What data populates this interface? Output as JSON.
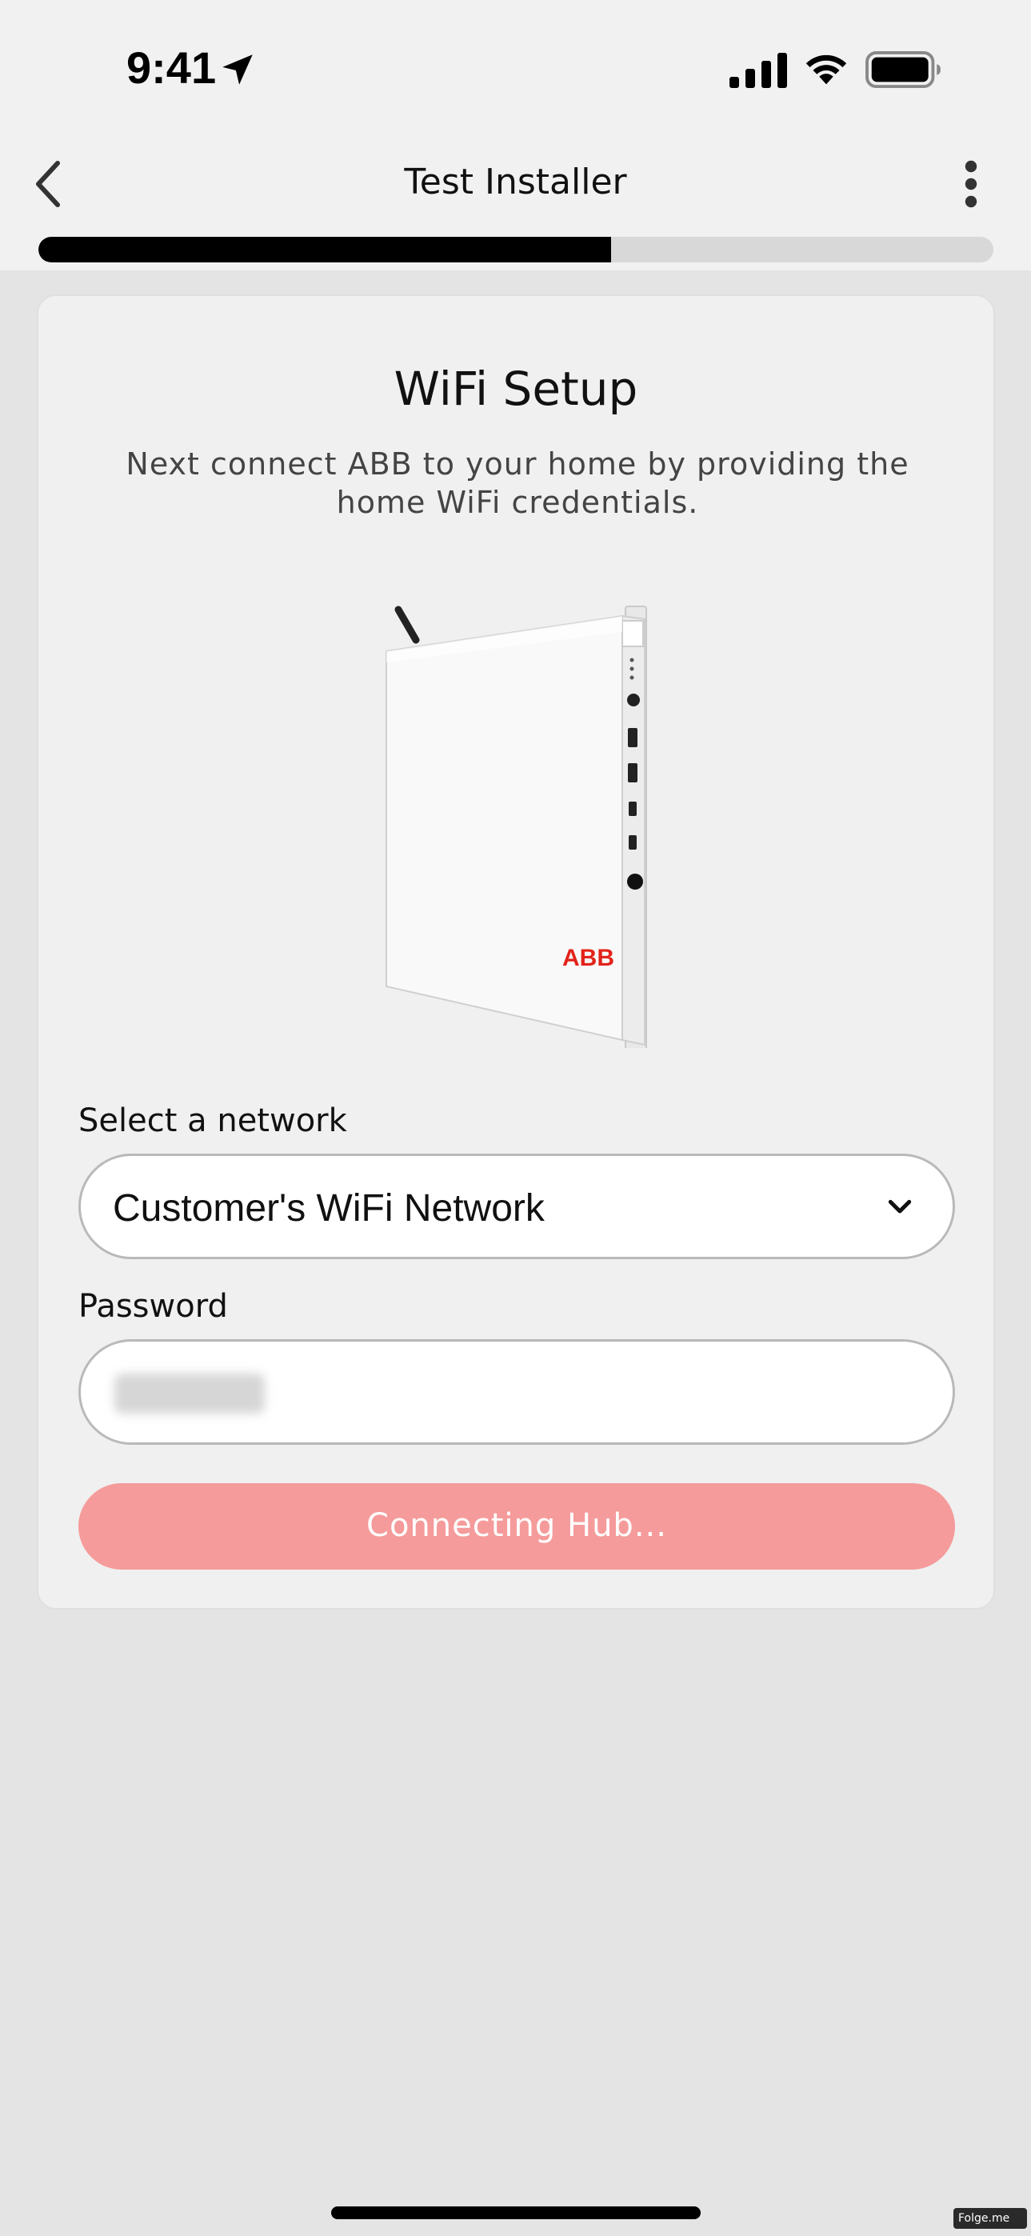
{
  "status_bar": {
    "time": "9:41",
    "location_icon": "location-arrow-icon",
    "signal_icon": "cellular-signal-icon",
    "wifi_icon": "wifi-icon",
    "battery_icon": "battery-full-icon"
  },
  "header": {
    "title": "Test Installer",
    "back_icon": "chevron-left-icon",
    "menu_icon": "more-vertical-icon"
  },
  "progress": {
    "value_fraction": 0.6
  },
  "card": {
    "title": "WiFi Setup",
    "description": "Next connect ABB to your home by providing the home WiFi credentials.",
    "device_logo": "ABB"
  },
  "form": {
    "network_label": "Select a network",
    "network_value": "Customer's WiFi Network",
    "password_label": "Password",
    "password_hidden": true,
    "submit_label": "Connecting Hub..."
  },
  "colors": {
    "accent": "#f59b9b",
    "brand_red": "#e2231a",
    "progress_fill": "#000000"
  },
  "watermark": "Folge.me"
}
